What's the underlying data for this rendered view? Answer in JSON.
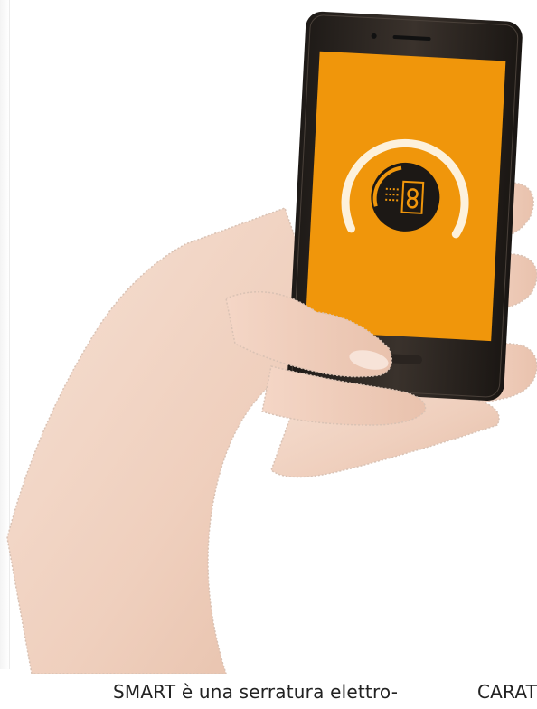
{
  "captions": {
    "left": "SMART è una serratura elettro-",
    "right": "CARATTER"
  },
  "illustration": {
    "subject": "hand-holding-smartphone",
    "screen_icon": "smart-lock-icon"
  },
  "colors": {
    "screen_orange": "#f0960b",
    "phone_body": "#2b2521",
    "gauge_white": "#fdf1dc",
    "skin": "#f3d8c8"
  }
}
